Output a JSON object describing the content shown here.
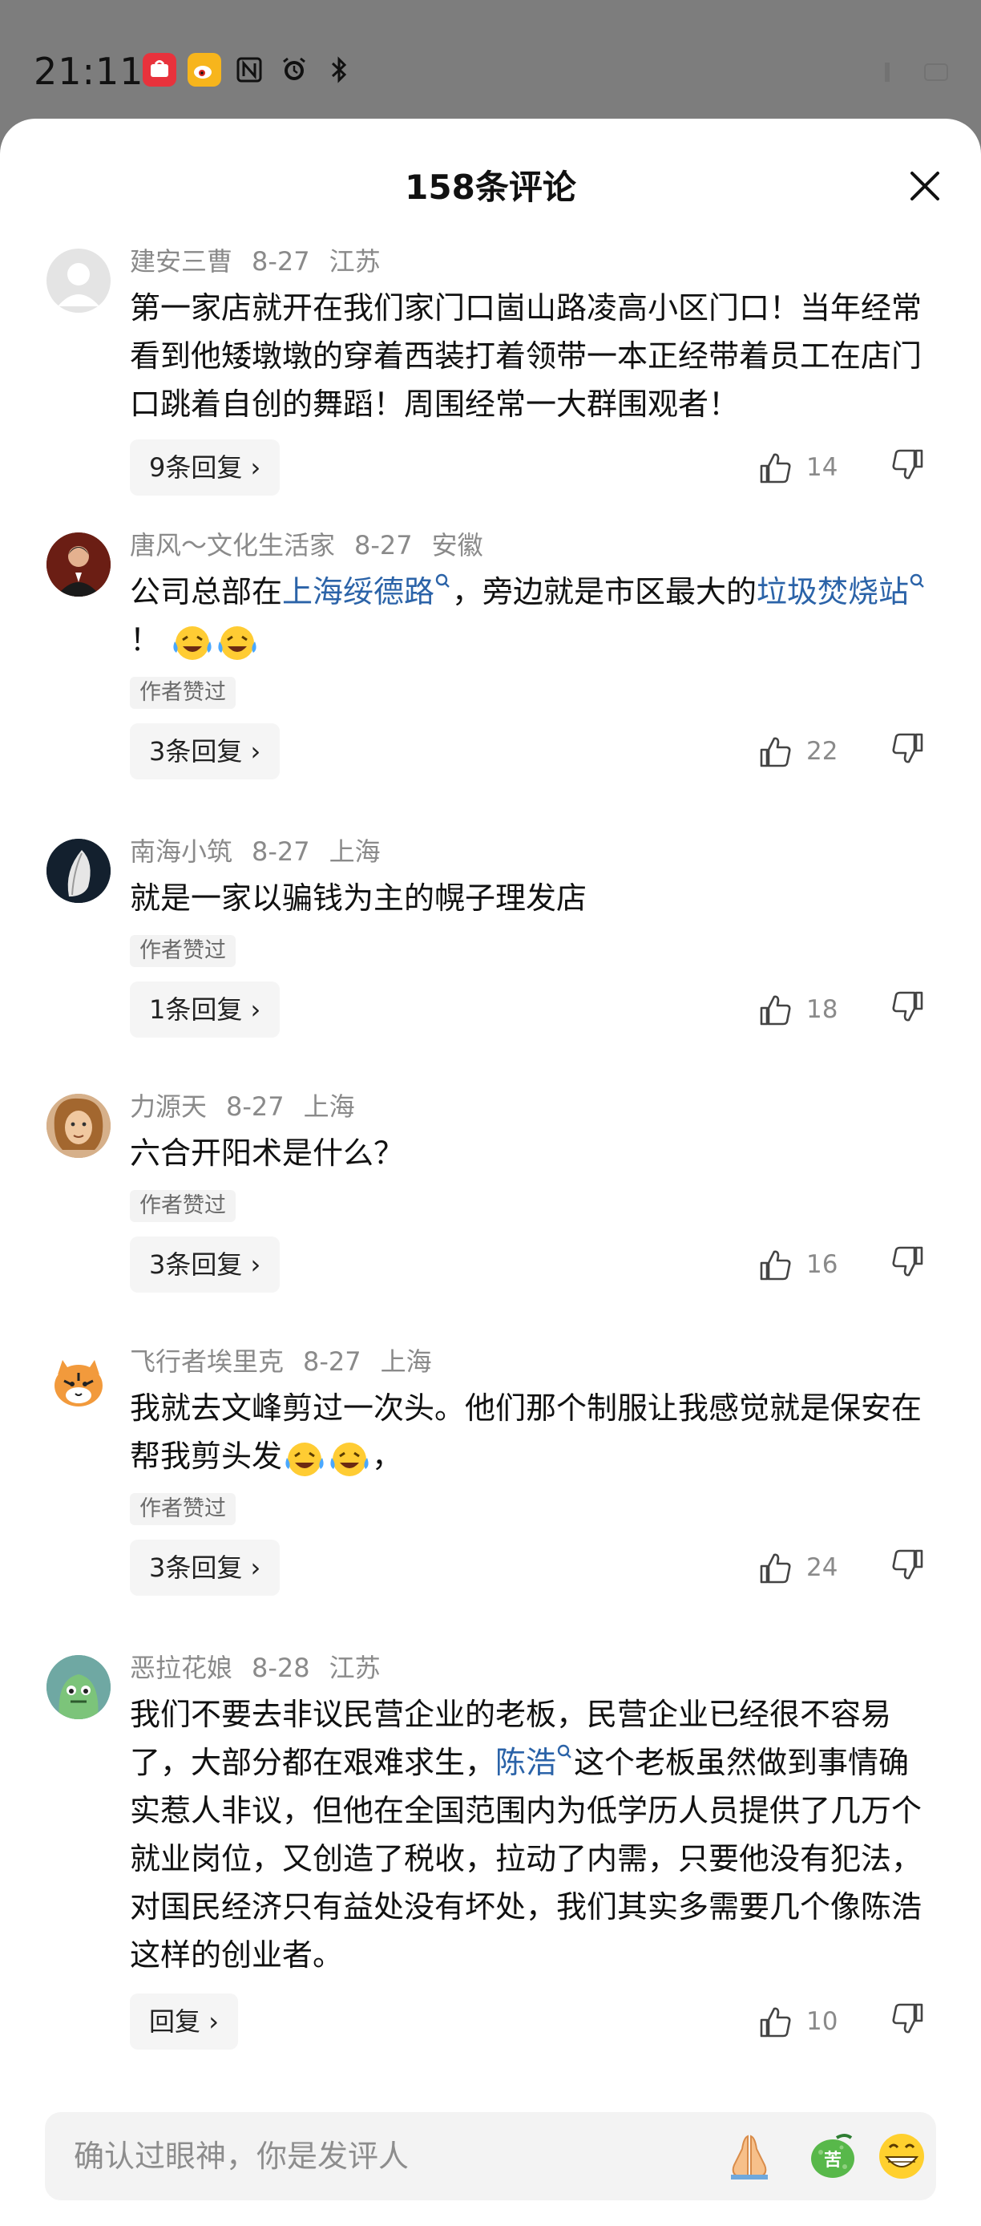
{
  "status_bar": {
    "time": "21:11",
    "icons": [
      "huawei-app-icon",
      "weibo-icon",
      "nfc-icon",
      "alarm-icon",
      "bluetooth-icon"
    ]
  },
  "sheet": {
    "title": "158条评论",
    "close_icon": "close-icon"
  },
  "comments": [
    {
      "author": "建安三曹",
      "date": "8-27",
      "location": "江苏",
      "text": "第一家店就开在我们家门口崮山路凌高小区门口！当年经常看到他矮墩墩的穿着西装打着领带一本正经带着员工在店门口跳着自创的舞蹈！周围经常一大群围观者！",
      "replies_label": "9条回复",
      "likes": "14",
      "author_liked": false
    },
    {
      "author": "唐风～文化生活家",
      "date": "8-27",
      "location": "安徽",
      "text_before": "公司总部在",
      "link1": "上海绥德路",
      "text_middle": "，旁边就是市区最大的",
      "link2": "垃圾焚烧站",
      "text_after": "！",
      "badge": "作者赞过",
      "replies_label": "3条回复",
      "likes": "22",
      "author_liked": true
    },
    {
      "author": "南海小筑",
      "date": "8-27",
      "location": "上海",
      "text": "就是一家以骗钱为主的幌子理发店",
      "badge": "作者赞过",
      "replies_label": "1条回复",
      "likes": "18",
      "author_liked": true
    },
    {
      "author": "力源天",
      "date": "8-27",
      "location": "上海",
      "text": "六合开阳术是什么？",
      "badge": "作者赞过",
      "replies_label": "3条回复",
      "likes": "16",
      "author_liked": true
    },
    {
      "author": "飞行者埃里克",
      "date": "8-27",
      "location": "上海",
      "text_before": "我就去文峰剪过一次头。他们那个制服让我感觉就是保安在帮我剪头发",
      "text_after": "，",
      "badge": "作者赞过",
      "replies_label": "3条回复",
      "likes": "24",
      "author_liked": true
    },
    {
      "author": "恶拉花娘",
      "date": "8-28",
      "location": "江苏",
      "text_before": "我们不要去非议民营企业的老板，民营企业已经很不容易了，大部分都在艰难求生，",
      "link1": "陈浩",
      "text_after": "这个老板虽然做到事情确实惹人非议，但他在全国范围内为低学历人员提供了几万个就业岗位，又创造了税收，拉动了内需，只要他没有犯法，对国民经济只有益处没有坏处，我们其实多需要几个像陈浩这样的创业者。",
      "replies_label": "回复",
      "likes": "10",
      "author_liked": false
    }
  ],
  "input": {
    "placeholder": "确认过眼神，你是发评人",
    "emoji_buttons": [
      "praying-hands-emoji",
      "bitter-melon-emoji",
      "grin-emoji"
    ]
  },
  "colors": {
    "link": "#2b63a8",
    "meta": "#8a8a8a",
    "badge_bg": "#f3f3f3",
    "reply_bg": "#f5f5f5",
    "backdrop": "#7d7d7d"
  }
}
